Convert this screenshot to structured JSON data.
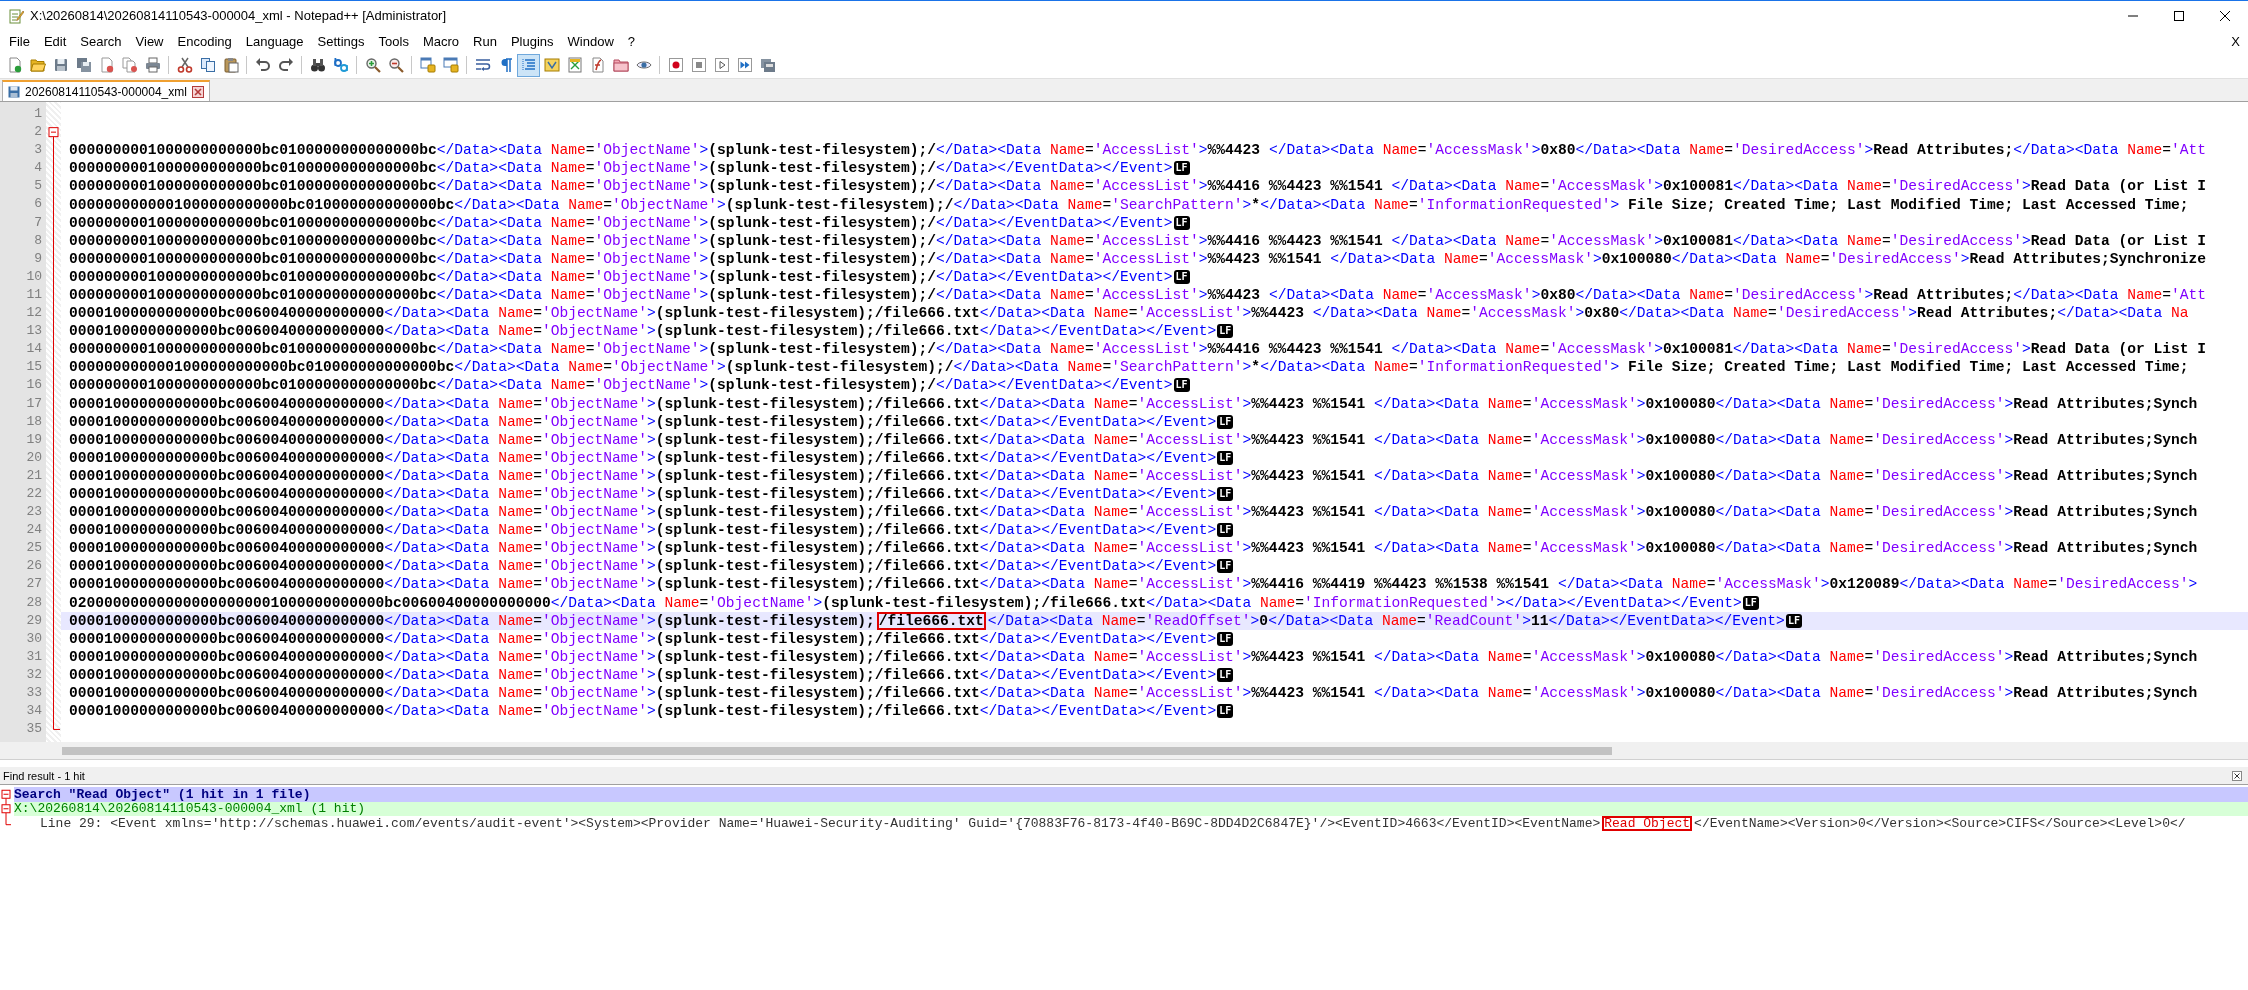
{
  "window": {
    "title": "X:\\20260814\\20260814110543-000004_xml - Notepad++ [Administrator]"
  },
  "menu": {
    "items": [
      "File",
      "Edit",
      "Search",
      "View",
      "Encoding",
      "Language",
      "Settings",
      "Tools",
      "Macro",
      "Run",
      "Plugins",
      "Window",
      "?"
    ],
    "close_label": "X"
  },
  "toolbar": {
    "buttons": [
      {
        "pressed": false
      },
      {
        "pressed": false
      },
      {
        "pressed": false
      },
      {
        "pressed": false
      },
      {
        "pressed": false
      },
      {
        "pressed": false
      },
      {
        "pressed": false
      },
      {
        "pressed": false
      },
      {
        "pressed": false
      },
      {
        "pressed": false
      },
      {
        "pressed": false
      },
      {
        "pressed": false
      },
      {
        "pressed": false
      },
      {
        "pressed": false
      },
      {
        "pressed": false
      },
      {
        "pressed": false
      },
      {
        "pressed": false
      },
      {
        "pressed": false
      },
      {
        "pressed": false
      },
      {
        "pressed": false
      },
      {
        "pressed": true
      },
      {
        "pressed": false
      },
      {
        "pressed": false
      },
      {
        "pressed": false
      },
      {
        "pressed": false
      },
      {
        "pressed": false
      },
      {
        "pressed": false
      },
      {
        "pressed": false
      },
      {
        "pressed": false
      },
      {
        "pressed": false
      },
      {
        "pressed": false
      }
    ]
  },
  "tabs": [
    {
      "label": "20260814110543-000004_xml",
      "selected": true
    }
  ],
  "editor": {
    "fold": {
      "expanded": true
    },
    "lines": [
      {
        "number": "1",
        "current": false
      },
      {
        "number": "2",
        "current": false
      },
      {
        "number": "3",
        "current": false,
        "segments": [
          {
            "text": "0000000001000000000000bc0100000000000000bc</Data><Data Name='ObjectName'>(splunk-test-filesystem);/</Data><Data Name='AccessList'>%%4423 </Data><Data Name='AccessMask'>0x80</Data><Data Name='DesiredAccess'>Read Attributes;</Data><Data Name='Att",
            "boxed": false
          }
        ]
      },
      {
        "number": "4",
        "current": false,
        "segments": [
          {
            "text": "0000000001000000000000bc0100000000000000bc</Data><Data Name='ObjectName'>(splunk-test-filesystem);/</Data></EventData></Event>",
            "boxed": false
          }
        ],
        "eol": "LF"
      },
      {
        "number": "5",
        "current": false,
        "segments": [
          {
            "text": "0000000001000000000000bc0100000000000000bc</Data><Data Name='ObjectName'>(splunk-test-filesystem);/</Data><Data Name='AccessList'>%%4416 %%4423 %%1541 </Data><Data Name='AccessMask'>0x100081</Data><Data Name='DesiredAccess'>Read Data (or List I",
            "boxed": false
          }
        ]
      },
      {
        "number": "6",
        "current": false,
        "segments": [
          {
            "text": "0000000000001000000000000bc010000000000000bc</Data><Data Name='ObjectName'>(splunk-test-filesystem);/</Data><Data Name='SearchPattern'>*</Data><Data Name='InformationRequested'> File Size; Created Time; Last Modified Time; Last Accessed Time;",
            "boxed": false
          }
        ]
      },
      {
        "number": "7",
        "current": false,
        "segments": [
          {
            "text": "0000000001000000000000bc0100000000000000bc</Data><Data Name='ObjectName'>(splunk-test-filesystem);/</Data></EventData></Event>",
            "boxed": false
          }
        ],
        "eol": "LF"
      },
      {
        "number": "8",
        "current": false,
        "segments": [
          {
            "text": "0000000001000000000000bc0100000000000000bc</Data><Data Name='ObjectName'>(splunk-test-filesystem);/</Data><Data Name='AccessList'>%%4416 %%4423 %%1541 </Data><Data Name='AccessMask'>0x100081</Data><Data Name='DesiredAccess'>Read Data (or List I",
            "boxed": false
          }
        ]
      },
      {
        "number": "9",
        "current": false,
        "segments": [
          {
            "text": "0000000001000000000000bc0100000000000000bc</Data><Data Name='ObjectName'>(splunk-test-filesystem);/</Data><Data Name='AccessList'>%%4423 %%1541 </Data><Data Name='AccessMask'>0x100080</Data><Data Name='DesiredAccess'>Read Attributes;Synchronize",
            "boxed": false
          }
        ]
      },
      {
        "number": "10",
        "current": false,
        "segments": [
          {
            "text": "0000000001000000000000bc0100000000000000bc</Data><Data Name='ObjectName'>(splunk-test-filesystem);/</Data></EventData></Event>",
            "boxed": false
          }
        ],
        "eol": "LF"
      },
      {
        "number": "11",
        "current": false,
        "segments": [
          {
            "text": "0000000001000000000000bc0100000000000000bc</Data><Data Name='ObjectName'>(splunk-test-filesystem);/</Data><Data Name='AccessList'>%%4423 </Data><Data Name='AccessMask'>0x80</Data><Data Name='DesiredAccess'>Read Attributes;</Data><Data Name='Att",
            "boxed": false
          }
        ]
      },
      {
        "number": "12",
        "current": false,
        "segments": [
          {
            "text": "00001000000000000bc00600400000000000</Data><Data Name='ObjectName'>(splunk-test-filesystem);/file666.txt</Data><Data Name='AccessList'>%%4423 </Data><Data Name='AccessMask'>0x80</Data><Data Name='DesiredAccess'>Read Attributes;</Data><Data Na",
            "boxed": false
          }
        ]
      },
      {
        "number": "13",
        "current": false,
        "segments": [
          {
            "text": "00001000000000000bc00600400000000000</Data><Data Name='ObjectName'>(splunk-test-filesystem);/file666.txt</Data></EventData></Event>",
            "boxed": false
          }
        ],
        "eol": "LF"
      },
      {
        "number": "14",
        "current": false,
        "segments": [
          {
            "text": "0000000001000000000000bc0100000000000000bc</Data><Data Name='ObjectName'>(splunk-test-filesystem);/</Data><Data Name='AccessList'>%%4416 %%4423 %%1541 </Data><Data Name='AccessMask'>0x100081</Data><Data Name='DesiredAccess'>Read Data (or List I",
            "boxed": false
          }
        ]
      },
      {
        "number": "15",
        "current": false,
        "segments": [
          {
            "text": "0000000000001000000000000bc010000000000000bc</Data><Data Name='ObjectName'>(splunk-test-filesystem);/</Data><Data Name='SearchPattern'>*</Data><Data Name='InformationRequested'> File Size; Created Time; Last Modified Time; Last Accessed Time;",
            "boxed": false
          }
        ]
      },
      {
        "number": "16",
        "current": false,
        "segments": [
          {
            "text": "0000000001000000000000bc0100000000000000bc</Data><Data Name='ObjectName'>(splunk-test-filesystem);/</Data></EventData></Event>",
            "boxed": false
          }
        ],
        "eol": "LF"
      },
      {
        "number": "17",
        "current": false,
        "segments": [
          {
            "text": "00001000000000000bc00600400000000000</Data><Data Name='ObjectName'>(splunk-test-filesystem);/file666.txt</Data><Data Name='AccessList'>%%4423 %%1541 </Data><Data Name='AccessMask'>0x100080</Data><Data Name='DesiredAccess'>Read Attributes;Synch",
            "boxed": false
          }
        ]
      },
      {
        "number": "18",
        "current": false,
        "segments": [
          {
            "text": "00001000000000000bc00600400000000000</Data><Data Name='ObjectName'>(splunk-test-filesystem);/file666.txt</Data></EventData></Event>",
            "boxed": false
          }
        ],
        "eol": "LF"
      },
      {
        "number": "19",
        "current": false,
        "segments": [
          {
            "text": "00001000000000000bc00600400000000000</Data><Data Name='ObjectName'>(splunk-test-filesystem);/file666.txt</Data><Data Name='AccessList'>%%4423 %%1541 </Data><Data Name='AccessMask'>0x100080</Data><Data Name='DesiredAccess'>Read Attributes;Synch",
            "boxed": false
          }
        ]
      },
      {
        "number": "20",
        "current": false,
        "segments": [
          {
            "text": "00001000000000000bc00600400000000000</Data><Data Name='ObjectName'>(splunk-test-filesystem);/file666.txt</Data></EventData></Event>",
            "boxed": false
          }
        ],
        "eol": "LF"
      },
      {
        "number": "21",
        "current": false,
        "segments": [
          {
            "text": "00001000000000000bc00600400000000000</Data><Data Name='ObjectName'>(splunk-test-filesystem);/file666.txt</Data><Data Name='AccessList'>%%4423 %%1541 </Data><Data Name='AccessMask'>0x100080</Data><Data Name='DesiredAccess'>Read Attributes;Synch",
            "boxed": false
          }
        ]
      },
      {
        "number": "22",
        "current": false,
        "segments": [
          {
            "text": "00001000000000000bc00600400000000000</Data><Data Name='ObjectName'>(splunk-test-filesystem);/file666.txt</Data></EventData></Event>",
            "boxed": false
          }
        ],
        "eol": "LF"
      },
      {
        "number": "23",
        "current": false,
        "segments": [
          {
            "text": "00001000000000000bc00600400000000000</Data><Data Name='ObjectName'>(splunk-test-filesystem);/file666.txt</Data><Data Name='AccessList'>%%4423 %%1541 </Data><Data Name='AccessMask'>0x100080</Data><Data Name='DesiredAccess'>Read Attributes;Synch",
            "boxed": false
          }
        ]
      },
      {
        "number": "24",
        "current": false,
        "segments": [
          {
            "text": "00001000000000000bc00600400000000000</Data><Data Name='ObjectName'>(splunk-test-filesystem);/file666.txt</Data></EventData></Event>",
            "boxed": false
          }
        ],
        "eol": "LF"
      },
      {
        "number": "25",
        "current": false,
        "segments": [
          {
            "text": "00001000000000000bc00600400000000000</Data><Data Name='ObjectName'>(splunk-test-filesystem);/file666.txt</Data><Data Name='AccessList'>%%4423 %%1541 </Data><Data Name='AccessMask'>0x100080</Data><Data Name='DesiredAccess'>Read Attributes;Synch",
            "boxed": false
          }
        ]
      },
      {
        "number": "26",
        "current": false,
        "segments": [
          {
            "text": "00001000000000000bc00600400000000000</Data><Data Name='ObjectName'>(splunk-test-filesystem);/file666.txt</Data></EventData></Event>",
            "boxed": false
          }
        ],
        "eol": "LF"
      },
      {
        "number": "27",
        "current": false,
        "segments": [
          {
            "text": "00001000000000000bc00600400000000000</Data><Data Name='ObjectName'>(splunk-test-filesystem);/file666.txt</Data><Data Name='AccessList'>%%4416 %%4419 %%4423 %%1538 %%1541 </Data><Data Name='AccessMask'>0x120089</Data><Data Name='DesiredAccess'>",
            "boxed": false
          }
        ]
      },
      {
        "number": "28",
        "current": false,
        "segments": [
          {
            "text": "020000000000000000000001000000000000bc00600400000000000</Data><Data Name='ObjectName'>(splunk-test-filesystem);/file666.txt</Data><Data Name='InformationRequested'></Data></EventData></Event>",
            "boxed": false
          }
        ],
        "eol": "LF"
      },
      {
        "number": "29",
        "current": true,
        "segments": [
          {
            "text": "00001000000000000bc00600400000000000</Data><Data Name='ObjectName'>(splunk-test-filesystem);",
            "boxed": false
          },
          {
            "text": "/file666.txt",
            "boxed": true
          },
          {
            "text": "</Data><Data Name='ReadOffset'>0</Data><Data Name='ReadCount'>11</Data></EventData></Event>",
            "boxed": false
          }
        ],
        "eol": "LF"
      },
      {
        "number": "30",
        "current": false,
        "segments": [
          {
            "text": "00001000000000000bc00600400000000000</Data><Data Name='ObjectName'>(splunk-test-filesystem);/file666.txt</Data></EventData></Event>",
            "boxed": false
          }
        ],
        "eol": "LF"
      },
      {
        "number": "31",
        "current": false,
        "segments": [
          {
            "text": "00001000000000000bc00600400000000000</Data><Data Name='ObjectName'>(splunk-test-filesystem);/file666.txt</Data><Data Name='AccessList'>%%4423 %%1541 </Data><Data Name='AccessMask'>0x100080</Data><Data Name='DesiredAccess'>Read Attributes;Synch",
            "boxed": false
          }
        ]
      },
      {
        "number": "32",
        "current": false,
        "segments": [
          {
            "text": "00001000000000000bc00600400000000000</Data><Data Name='ObjectName'>(splunk-test-filesystem);/file666.txt</Data></EventData></Event>",
            "boxed": false
          }
        ],
        "eol": "LF"
      },
      {
        "number": "33",
        "current": false,
        "segments": [
          {
            "text": "00001000000000000bc00600400000000000</Data><Data Name='ObjectName'>(splunk-test-filesystem);/file666.txt</Data><Data Name='AccessList'>%%4423 %%1541 </Data><Data Name='AccessMask'>0x100080</Data><Data Name='DesiredAccess'>Read Attributes;Synch",
            "boxed": false
          }
        ]
      },
      {
        "number": "34",
        "current": false,
        "segments": [
          {
            "text": "00001000000000000bc00600400000000000</Data><Data Name='ObjectName'>(splunk-test-filesystem);/file666.txt</Data></EventData></Event>",
            "boxed": false
          }
        ],
        "eol": "LF"
      },
      {
        "number": "35",
        "current": false
      }
    ]
  },
  "find_panel": {
    "title": "Find result - 1 hit",
    "search": {
      "text": "Search \"Read Object\" (1 hit in 1 file)",
      "expanded": true
    },
    "file": {
      "text": "X:\\20260814\\20260814110543-000004_xml (1 hit)",
      "expanded": true
    },
    "hits": [
      {
        "segments": [
          {
            "text": "Line 29: <Event xmlns='http://schemas.huawei.com/events/audit-event'><System><Provider Name='Huawei-Security-Auditing' Guid='{70883F76-8173-4f40-B69C-8DD4D2C6847E}'/><EventID>4663</EventID><EventName>",
            "boxed": false
          },
          {
            "text": "Read Object",
            "boxed": true
          },
          {
            "text": "</EventName><Version>0</Version><Source>CIFS</Source><Level>0</",
            "boxed": false
          }
        ]
      }
    ]
  }
}
